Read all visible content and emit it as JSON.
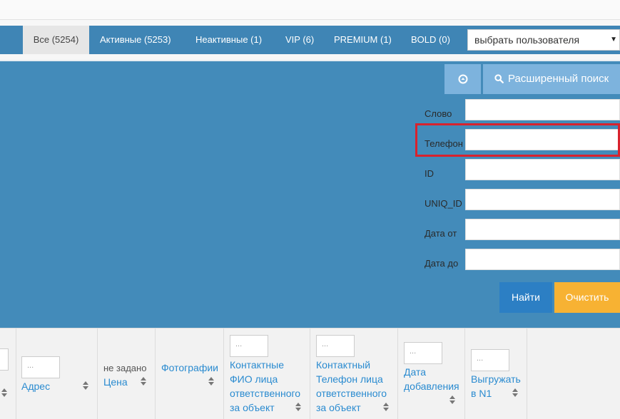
{
  "tabs": [
    {
      "label": "Все (5254)",
      "active": true
    },
    {
      "label": "Активные (5253)",
      "active": false
    },
    {
      "label": "Неактивные (1)",
      "active": false
    },
    {
      "label": "VIP (6)",
      "active": false
    },
    {
      "label": "PREMIUM (1)",
      "active": false
    },
    {
      "label": "BOLD (0)",
      "active": false
    }
  ],
  "user_select": {
    "value": "выбрать пользователя",
    "arrow": "▼"
  },
  "search": {
    "toggle_icon": "circle-arrow-icon",
    "advanced_label": "Расширенный поиск",
    "fields": [
      {
        "label": "Слово",
        "value": ""
      },
      {
        "label": "Телефон",
        "value": ""
      },
      {
        "label": "ID",
        "value": ""
      },
      {
        "label": "UNIQ_ID",
        "value": ""
      },
      {
        "label": "Дата от",
        "value": ""
      },
      {
        "label": "Дата до",
        "value": ""
      }
    ],
    "find_label": "Найти",
    "clear_label": "Очистить"
  },
  "columns": {
    "filter_placeholder": "...",
    "address": "Адрес",
    "price_prefix": "не задано",
    "price": "Цена",
    "photos": "Фотографии",
    "contact_name": [
      "Контактные",
      "ФИО лица",
      "ответственного",
      "за объект"
    ],
    "contact_phone": [
      "Контактный",
      "Телефон лица",
      "ответственного",
      "за объект"
    ],
    "date_added": [
      "Дата",
      "добавления"
    ],
    "export_n1": [
      "Выгружать",
      "в N1"
    ]
  },
  "colors": {
    "tab_bar": "#3f85b5",
    "panel": "#438bba",
    "button_light": "#7db3dd",
    "find": "#2c7fc4",
    "clear": "#f7b233",
    "highlight": "#d9222d",
    "link": "#2a8bd0"
  }
}
